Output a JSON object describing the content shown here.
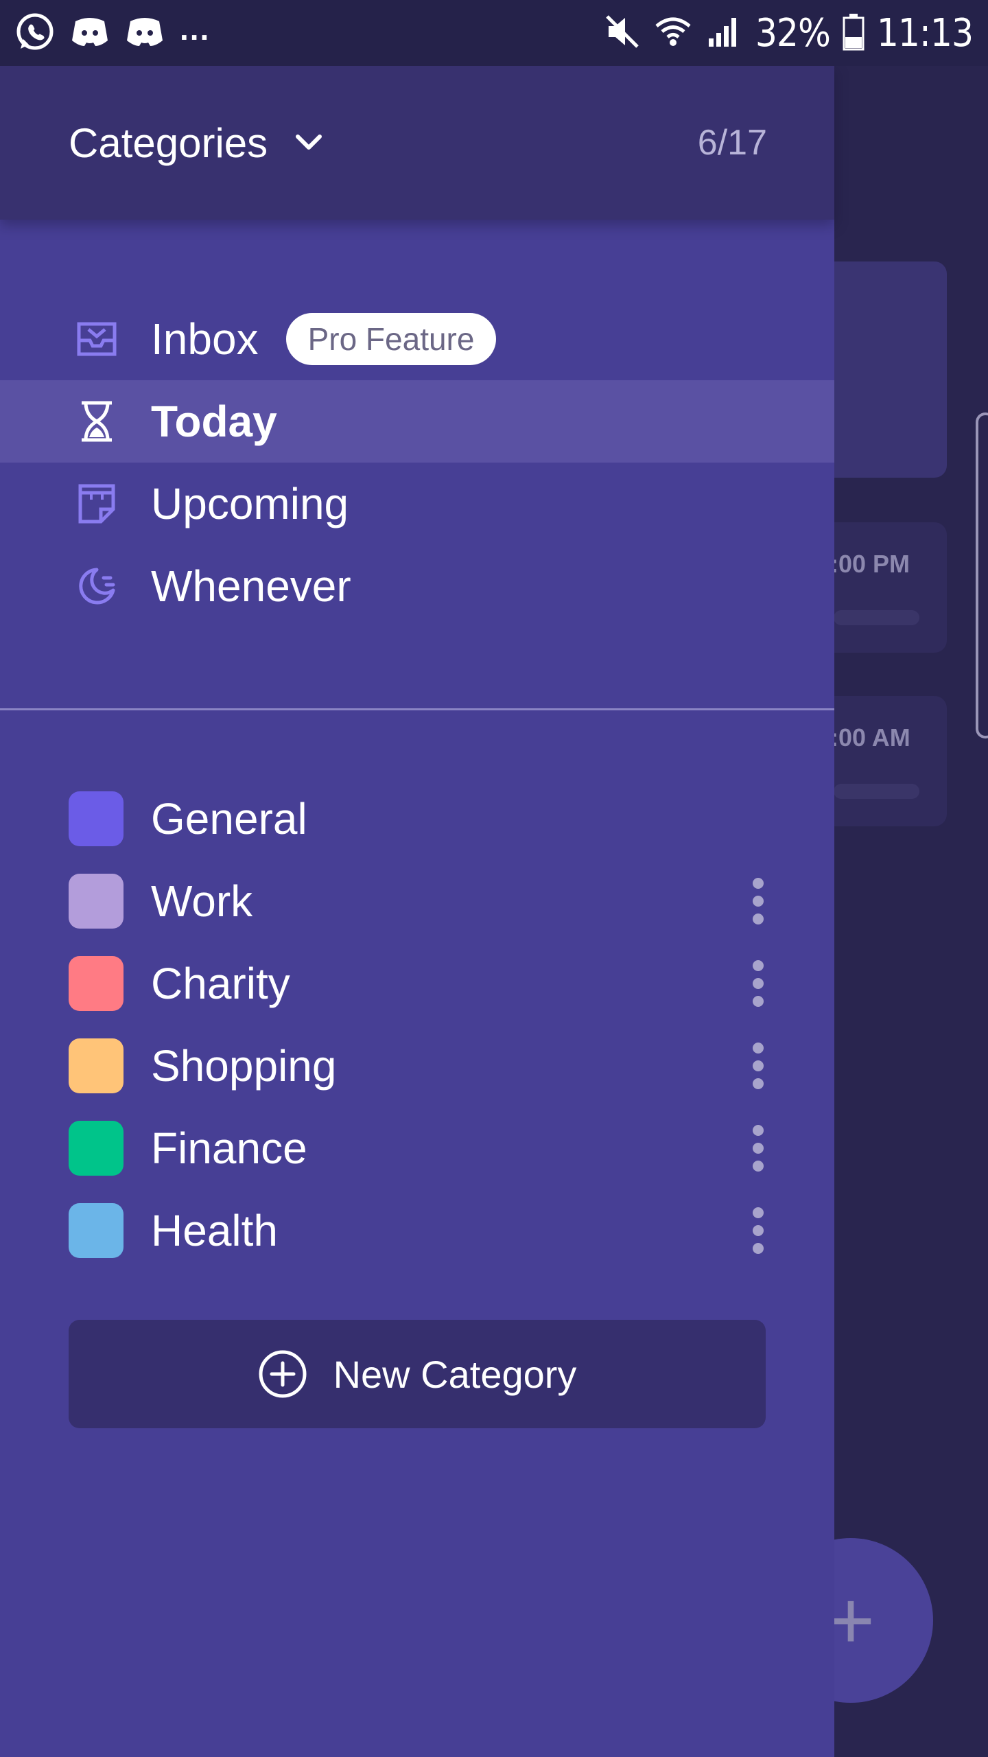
{
  "status_bar": {
    "battery": "32%",
    "time": "11:13",
    "dots": "...",
    "icons": [
      "whatsapp-icon",
      "discord-icon",
      "discord-icon",
      "mute-icon",
      "wifi-icon",
      "signal-icon",
      "battery-icon"
    ]
  },
  "header": {
    "title": "Categories",
    "count": "6/17"
  },
  "nav": {
    "items": [
      {
        "label": "Inbox",
        "icon": "inbox-icon",
        "badge": "Pro Feature"
      },
      {
        "label": "Today",
        "icon": "hourglass-icon",
        "active": true
      },
      {
        "label": "Upcoming",
        "icon": "note-icon"
      },
      {
        "label": "Whenever",
        "icon": "moon-icon"
      }
    ]
  },
  "categories": {
    "items": [
      {
        "label": "General",
        "color": "#6b5ce7"
      },
      {
        "label": "Work",
        "color": "#b39ddb"
      },
      {
        "label": "Charity",
        "color": "#ff7b84"
      },
      {
        "label": "Shopping",
        "color": "#ffc478"
      },
      {
        "label": "Finance",
        "color": "#00c48a"
      },
      {
        "label": "Health",
        "color": "#6bb5e8"
      }
    ],
    "new_label": "New Category"
  },
  "background": {
    "time_1": ":00 PM",
    "time_2": ":00 AM",
    "fab_symbol": "+"
  },
  "colors": {
    "drawer": "#473f95",
    "header": "#38316f",
    "active_row": "#5a51a3",
    "icon_accent": "#8a7cf0"
  }
}
